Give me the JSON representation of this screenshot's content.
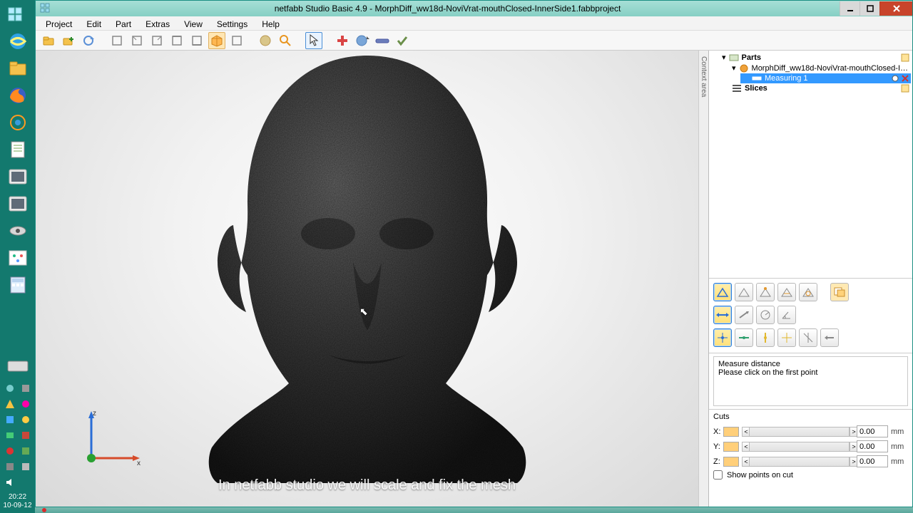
{
  "window": {
    "title": "netfabb Studio Basic 4.9 - MorphDiff_ww18d-NoviVrat-mouthClosed-InnerSide1.fabbproject"
  },
  "menu": [
    "Project",
    "Edit",
    "Part",
    "Extras",
    "View",
    "Settings",
    "Help"
  ],
  "tree": {
    "root": "Parts",
    "part": "MorphDiff_ww18d-NoviVrat-mouthClosed-In…",
    "measuring": "Measuring 1",
    "slices": "Slices"
  },
  "statusPanel": {
    "title": "Measure distance",
    "hint": "Please click on the first point"
  },
  "cuts": {
    "header": "Cuts",
    "x_label": "X:",
    "y_label": "Y:",
    "z_label": "Z:",
    "x_val": "0.00",
    "y_val": "0.00",
    "z_val": "0.00",
    "unit": "mm",
    "show_label": "Show points on cut",
    "show_checked": false
  },
  "caption": "In netfabb studio we will scale and fix the mesh",
  "contextTab": "Context area",
  "axes": {
    "x": "x",
    "z": "z"
  },
  "taskbar": {
    "time": "20:22",
    "date": "10-09-12"
  }
}
